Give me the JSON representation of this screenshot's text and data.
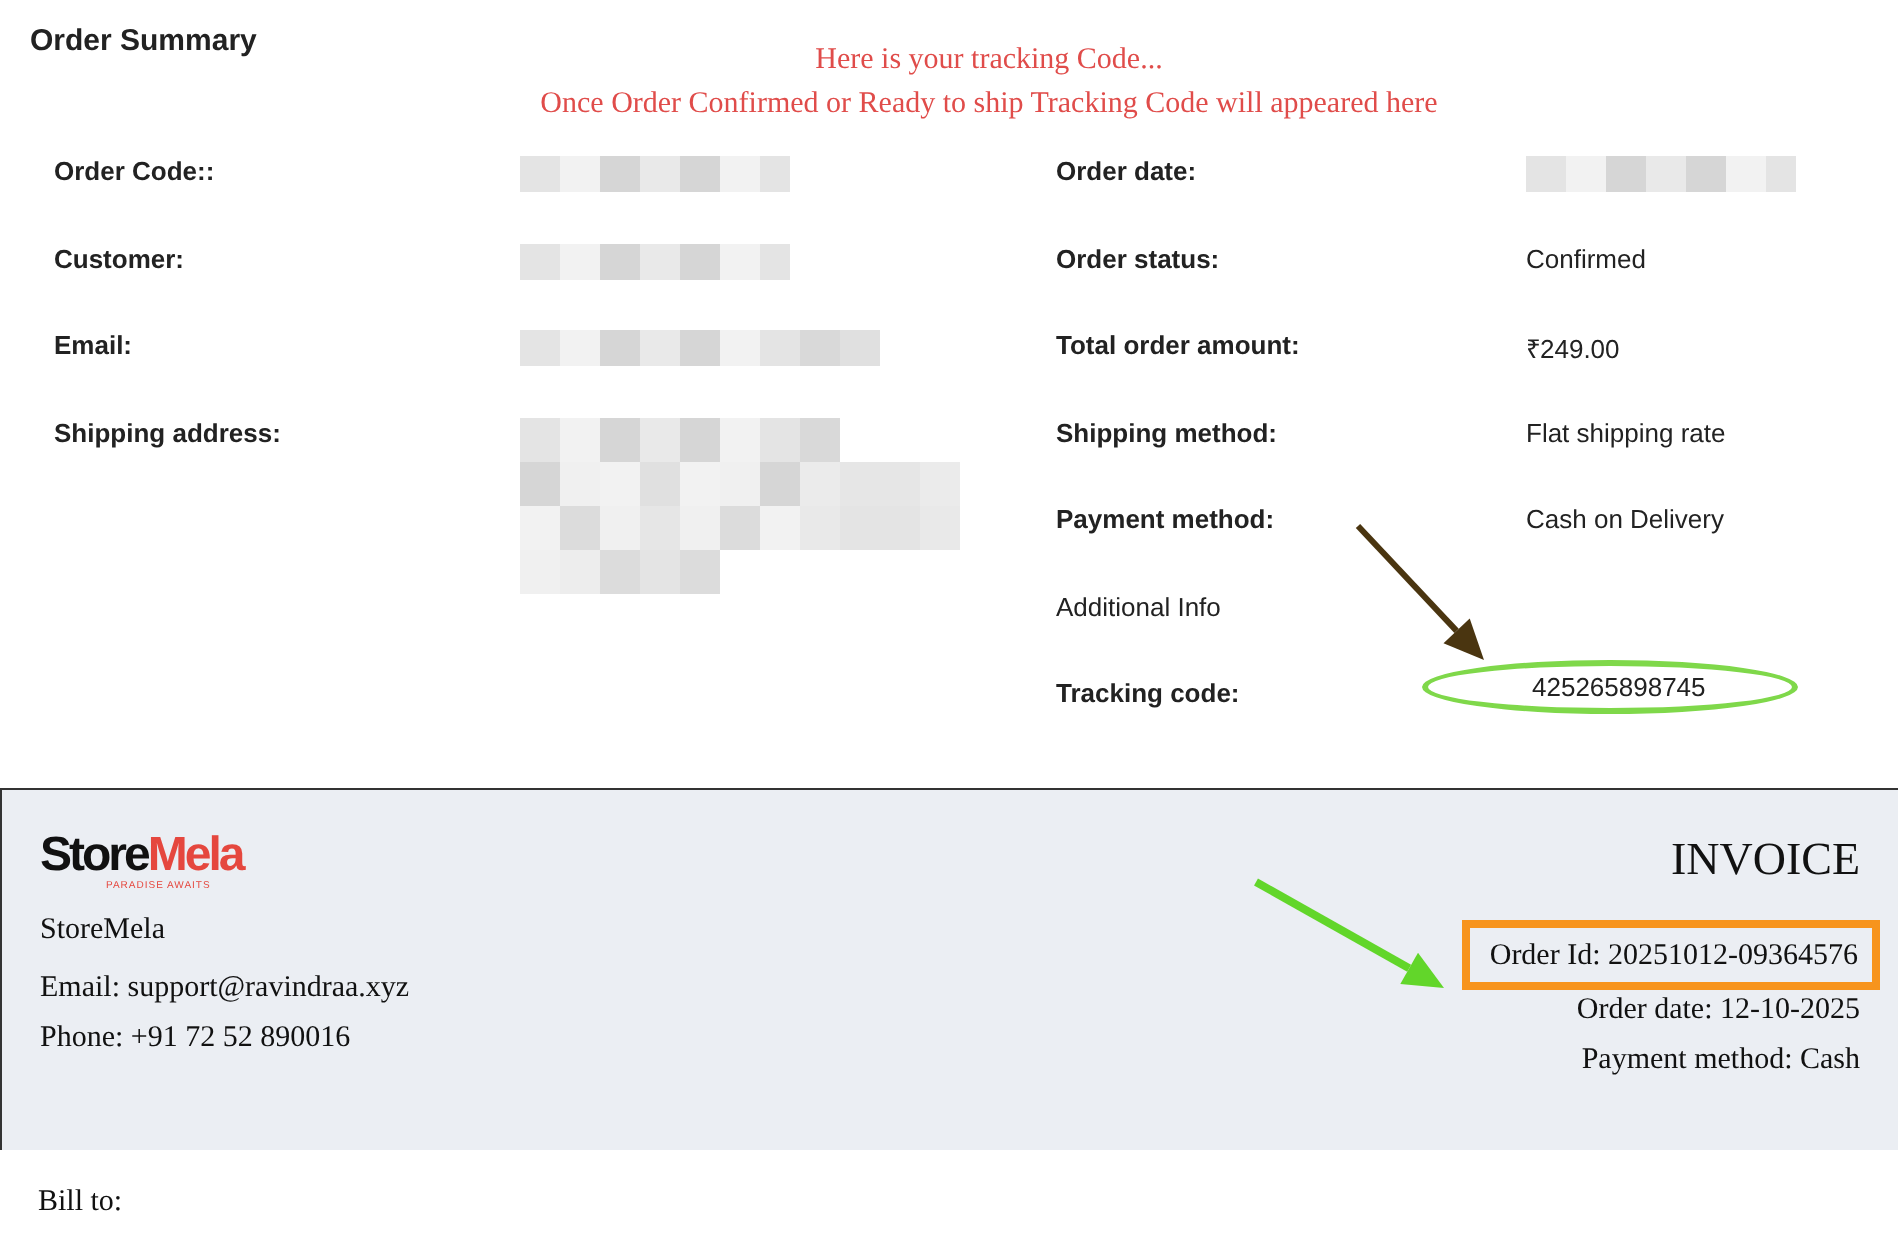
{
  "order_summary": {
    "title": "Order Summary",
    "notice": [
      "Here is your tracking Code...",
      "Once Order Confirmed or Ready to ship Tracking Code will appeared here"
    ],
    "left_fields": [
      {
        "label": "Order Code::",
        "value": {
          "kind": "short"
        }
      },
      {
        "label": "Customer:",
        "value": {
          "kind": "short"
        }
      },
      {
        "label": "Email:",
        "value": {
          "kind": "long"
        }
      },
      {
        "label": "Shipping address:",
        "value": {
          "kind": "block"
        }
      }
    ],
    "right_fields": [
      {
        "kind": "field",
        "label": "Order date:",
        "value": {
          "kind": "short"
        }
      },
      {
        "kind": "field",
        "label": "Order status:",
        "value": {
          "kind": "text",
          "text": "Confirmed"
        }
      },
      {
        "kind": "field",
        "label": "Total order amount:",
        "value": {
          "kind": "text",
          "text": "₹249.00"
        }
      },
      {
        "kind": "field",
        "label": "Shipping method:",
        "value": {
          "kind": "text",
          "text": "Flat shipping rate"
        }
      },
      {
        "kind": "field",
        "label": "Payment method:",
        "value": {
          "kind": "text",
          "text": "Cash on Delivery"
        }
      },
      {
        "kind": "note",
        "label": "Additional Info"
      },
      {
        "kind": "field",
        "label": "Tracking code:",
        "value": {
          "kind": "text",
          "text": "425265898745"
        },
        "highlighted": true
      }
    ]
  },
  "invoice": {
    "logo": {
      "parts": [
        "Store",
        "Mela"
      ],
      "tagline": "PARADISE AWAITS"
    },
    "heading": "INVOICE",
    "seller_lines": [
      "StoreMela",
      "Email: support@ravindraa.xyz",
      "Phone: +91 72 52 890016"
    ],
    "order_lines": [
      {
        "text": "Order Id: 20251012-09364576",
        "boxed": true
      },
      {
        "text": "Order date: 12-10-2025",
        "boxed": false
      },
      {
        "text": "Payment method: Cash",
        "boxed": false
      }
    ],
    "bill_to": "Bill to:"
  },
  "annotations": [
    {
      "kind": "arrow",
      "color": "#4a3510"
    },
    {
      "kind": "arrow",
      "color": "#62d62a"
    }
  ]
}
